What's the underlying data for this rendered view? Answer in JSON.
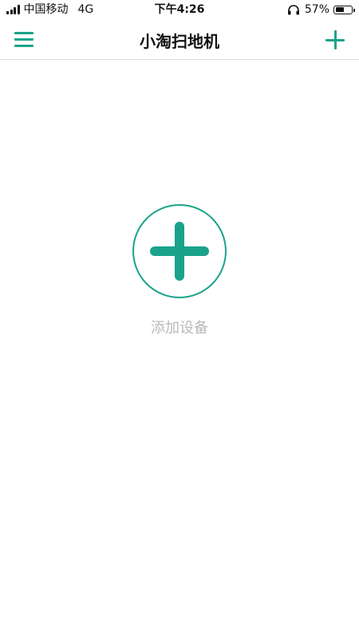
{
  "status_bar": {
    "carrier": "中国移动",
    "network": "4G",
    "time": "下午4:26",
    "battery_percent": "57%",
    "battery_level": 0.57
  },
  "nav": {
    "title": "小淘扫地机",
    "menu_icon": "hamburger-menu-icon",
    "add_icon": "plus-icon"
  },
  "main": {
    "add_device_label": "添加设备",
    "add_device_icon": "plus-circle-icon"
  },
  "colors": {
    "accent": "#1aa38a",
    "hint_text": "#b9b9b9"
  }
}
